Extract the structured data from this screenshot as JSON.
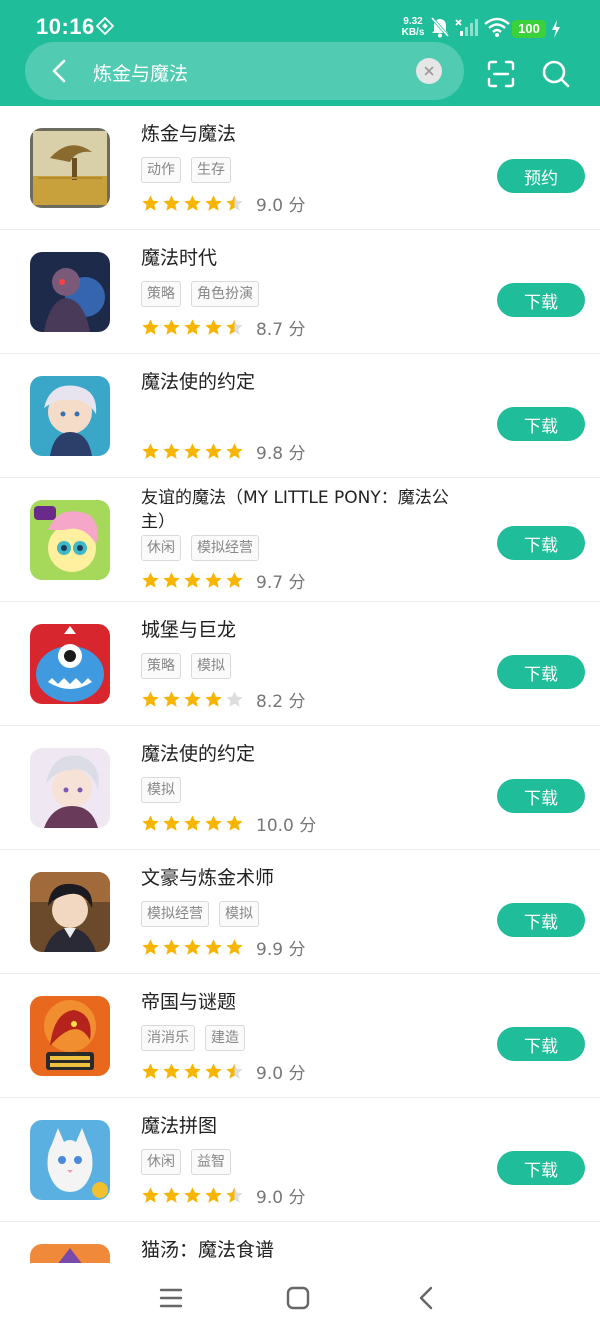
{
  "status_bar": {
    "time": "10:16",
    "net_speed_value": "9.32",
    "net_speed_unit": "KB/s",
    "battery": "100"
  },
  "search": {
    "query": "炼金与魔法"
  },
  "apps": [
    {
      "name": "炼金与魔法",
      "tags": [
        "动作",
        "生存"
      ],
      "rating": 4.5,
      "score": "9.0 分",
      "action": "预约"
    },
    {
      "name": "魔法时代",
      "tags": [
        "策略",
        "角色扮演"
      ],
      "rating": 4.5,
      "score": "8.7 分",
      "action": "下载"
    },
    {
      "name": "魔法使的约定",
      "tags": [],
      "rating": 5,
      "score": "9.8 分",
      "action": "下载"
    },
    {
      "name": "友谊的魔法（MY LITTLE PONY：魔法公主）",
      "tags": [
        "休闲",
        "模拟经营"
      ],
      "rating": 5,
      "score": "9.7 分",
      "action": "下载"
    },
    {
      "name": "城堡与巨龙",
      "tags": [
        "策略",
        "模拟"
      ],
      "rating": 4,
      "score": "8.2 分",
      "action": "下载"
    },
    {
      "name": "魔法使的约定",
      "tags": [
        "模拟"
      ],
      "rating": 5,
      "score": "10.0 分",
      "action": "下载"
    },
    {
      "name": "文豪与炼金术师",
      "tags": [
        "模拟经营",
        "模拟"
      ],
      "rating": 5,
      "score": "9.9 分",
      "action": "下载"
    },
    {
      "name": "帝国与谜题",
      "tags": [
        "消消乐",
        "建造"
      ],
      "rating": 4.5,
      "score": "9.0 分",
      "action": "下载"
    },
    {
      "name": "魔法拼图",
      "tags": [
        "休闲",
        "益智"
      ],
      "rating": 4.5,
      "score": "9.0 分",
      "action": "下载"
    },
    {
      "name": "猫汤：魔法食谱",
      "tags": [],
      "rating": 0,
      "score": "",
      "action": ""
    }
  ],
  "colors": {
    "accent": "#20bd9b",
    "star": "#f7b500",
    "star_empty": "#dddddd"
  }
}
